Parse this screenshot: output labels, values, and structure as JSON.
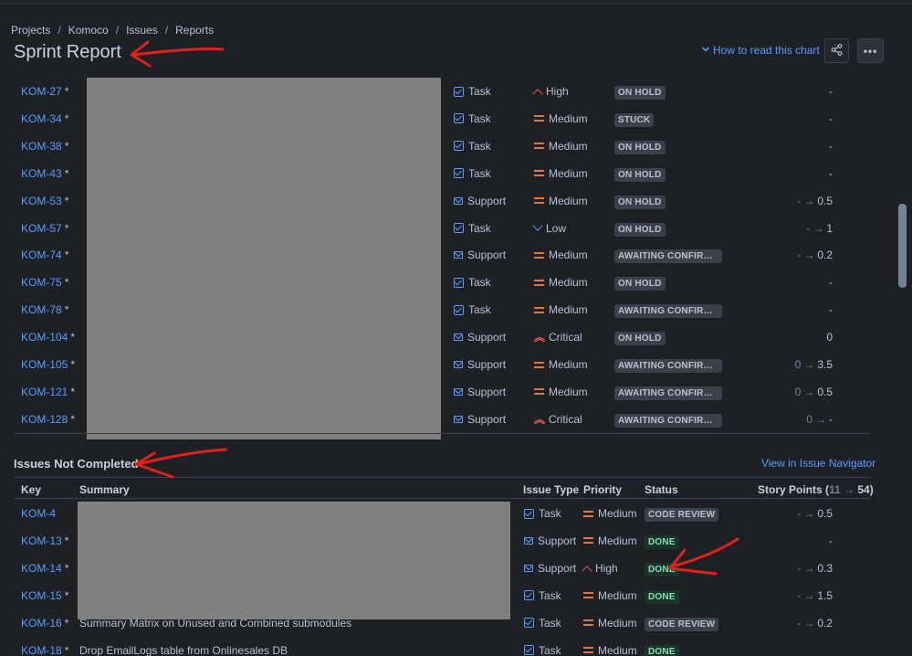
{
  "breadcrumb": [
    "Projects",
    "Komoco",
    "Issues",
    "Reports"
  ],
  "title": "Sprint Report",
  "how_to_read": "How to read this chart",
  "colors": {
    "link": "#579dff",
    "medium": "#e2763c",
    "high": "#f15b50",
    "done": "#7ee2b8",
    "annotation": "#e0201b"
  },
  "upper_rows": [
    {
      "key": "KOM-27",
      "type": "Task",
      "priority": "High",
      "status": "ON HOLD",
      "points_from": "",
      "points_to": "-"
    },
    {
      "key": "KOM-34",
      "type": "Task",
      "priority": "Medium",
      "status": "STUCK",
      "points_from": "",
      "points_to": "-"
    },
    {
      "key": "KOM-38",
      "type": "Task",
      "priority": "Medium",
      "status": "ON HOLD",
      "points_from": "",
      "points_to": "-"
    },
    {
      "key": "KOM-43",
      "type": "Task",
      "priority": "Medium",
      "status": "ON HOLD",
      "points_from": "",
      "points_to": "-"
    },
    {
      "key": "KOM-53",
      "type": "Support",
      "priority": "Medium",
      "status": "ON HOLD",
      "points_from": "-",
      "points_to": "0.5"
    },
    {
      "key": "KOM-57",
      "type": "Task",
      "priority": "Low",
      "status": "ON HOLD",
      "points_from": "-",
      "points_to": "1"
    },
    {
      "key": "KOM-74",
      "type": "Support",
      "priority": "Medium",
      "status": "AWAITING CONFIRMATION",
      "points_from": "-",
      "points_to": "0.2"
    },
    {
      "key": "KOM-75",
      "type": "Task",
      "priority": "Medium",
      "status": "ON HOLD",
      "points_from": "",
      "points_to": "-"
    },
    {
      "key": "KOM-78",
      "type": "Task",
      "priority": "Medium",
      "status": "AWAITING CONFIRMATION",
      "points_from": "",
      "points_to": "-"
    },
    {
      "key": "KOM-104",
      "type": "Support",
      "priority": "Critical",
      "status": "ON HOLD",
      "points_from": "",
      "points_to": "0"
    },
    {
      "key": "KOM-105",
      "type": "Support",
      "priority": "Medium",
      "status": "AWAITING CONFIRMATION",
      "points_from": "0",
      "points_to": "3.5"
    },
    {
      "key": "KOM-121",
      "type": "Support",
      "priority": "Medium",
      "status": "AWAITING CONFIRMATION",
      "points_from": "0",
      "points_to": "0.5"
    },
    {
      "key": "KOM-128",
      "type": "Support",
      "priority": "Critical",
      "status": "AWAITING CONFIRMATION",
      "points_from": "0",
      "points_to": "-"
    }
  ],
  "not_completed": {
    "title": "Issues Not Completed",
    "view_link": "View in Issue Navigator",
    "headers": {
      "key": "Key",
      "summary": "Summary",
      "issue_type": "Issue Type",
      "priority": "Priority",
      "status": "Status",
      "story_points": "Story Points (",
      "sp_from": "11",
      "sp_to": "54",
      "sp_close": ")"
    },
    "rows": [
      {
        "key": "KOM-4",
        "star": false,
        "summary": "",
        "type": "Task",
        "priority": "Medium",
        "status": "CODE REVIEW",
        "points_from": "-",
        "points_to": "0.5"
      },
      {
        "key": "KOM-13",
        "star": true,
        "summary": "",
        "type": "Support",
        "priority": "Medium",
        "status": "DONE",
        "points_from": "",
        "points_to": "-"
      },
      {
        "key": "KOM-14",
        "star": true,
        "summary": "",
        "type": "Support",
        "priority": "High",
        "status": "DONE",
        "points_from": "-",
        "points_to": "0.3"
      },
      {
        "key": "KOM-15",
        "star": true,
        "summary": "",
        "type": "Task",
        "priority": "Medium",
        "status": "DONE",
        "points_from": "-",
        "points_to": "1.5"
      },
      {
        "key": "KOM-16",
        "star": true,
        "summary": "Summary Matrix on Unused and Combined submodules",
        "type": "Task",
        "priority": "Medium",
        "status": "CODE REVIEW",
        "points_from": "-",
        "points_to": "0.2"
      },
      {
        "key": "KOM-18",
        "star": true,
        "summary": "Drop EmailLogs table from Onlinesales DB",
        "type": "Task",
        "priority": "Medium",
        "status": "DONE",
        "points_from": "",
        "points_to": ""
      }
    ]
  }
}
